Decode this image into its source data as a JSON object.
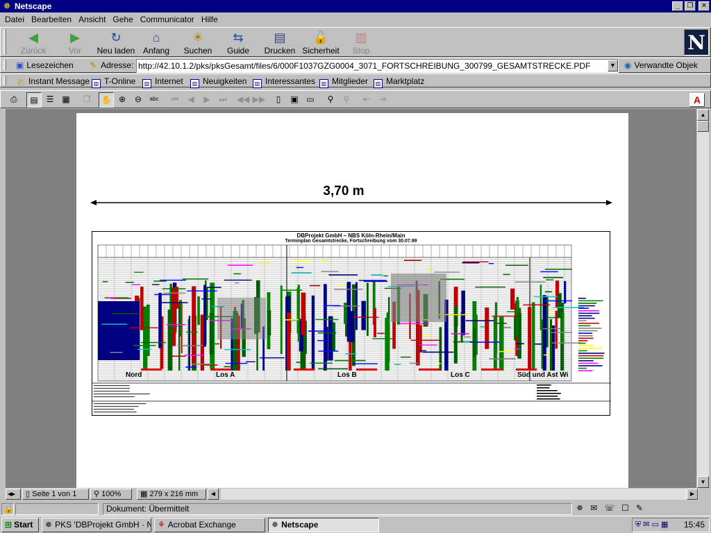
{
  "window": {
    "title": "Netscape"
  },
  "menu": [
    {
      "label": "Datei",
      "accel": "D"
    },
    {
      "label": "Bearbeiten",
      "accel": "B"
    },
    {
      "label": "Ansicht",
      "accel": "A"
    },
    {
      "label": "Gehe",
      "accel": "G"
    },
    {
      "label": "Communicator",
      "accel": "C"
    },
    {
      "label": "Hilfe",
      "accel": "H"
    }
  ],
  "nav": {
    "back": "Zurück",
    "forward": "Vor",
    "reload": "Neu laden",
    "home": "Anfang",
    "search": "Suchen",
    "guide": "Guide",
    "print": "Drucken",
    "security": "Sicherheit",
    "stop": "Stop"
  },
  "location": {
    "bookmarks": "Lesezeichen",
    "address_label": "Adresse:",
    "url": "http://42.10.1.2/pks/pksGesamt/files/6/000F1037GZG0004_3071_FORTSCHREIBUNG_300799_GESAMTSTRECKE.PDF",
    "related": "Verwandte Objek"
  },
  "personal": [
    "Instant Message",
    "T-Online",
    "Internet",
    "Neuigkeiten",
    "Interessantes",
    "Mitglieder",
    "Marktplatz"
  ],
  "document": {
    "dimension_label": "3,70 m",
    "drawing_title": "DBProjekt GmbH – NBS Köln-Rhein/Main",
    "drawing_subtitle": "Terminplan Gesamtstrecke, Fortschreibung vom 30.07.99",
    "sections": [
      "Nord",
      "Los A",
      "Los B",
      "Los C",
      "Süd und Ast Wi"
    ]
  },
  "acro_status": {
    "page": "Seite 1 von 1",
    "zoom": "100%",
    "size": "279 x 216 mm"
  },
  "ns_status": {
    "text": "Dokument: Übermittelt"
  },
  "taskbar": {
    "start": "Start",
    "tasks": [
      "PKS 'DBProjekt GmbH · N...",
      "Acrobat Exchange",
      "Netscape"
    ],
    "clock": "15:45"
  },
  "colors": {
    "title_bar": "#000080",
    "chrome": "#c0c0c0",
    "doc_bg": "#808080"
  }
}
